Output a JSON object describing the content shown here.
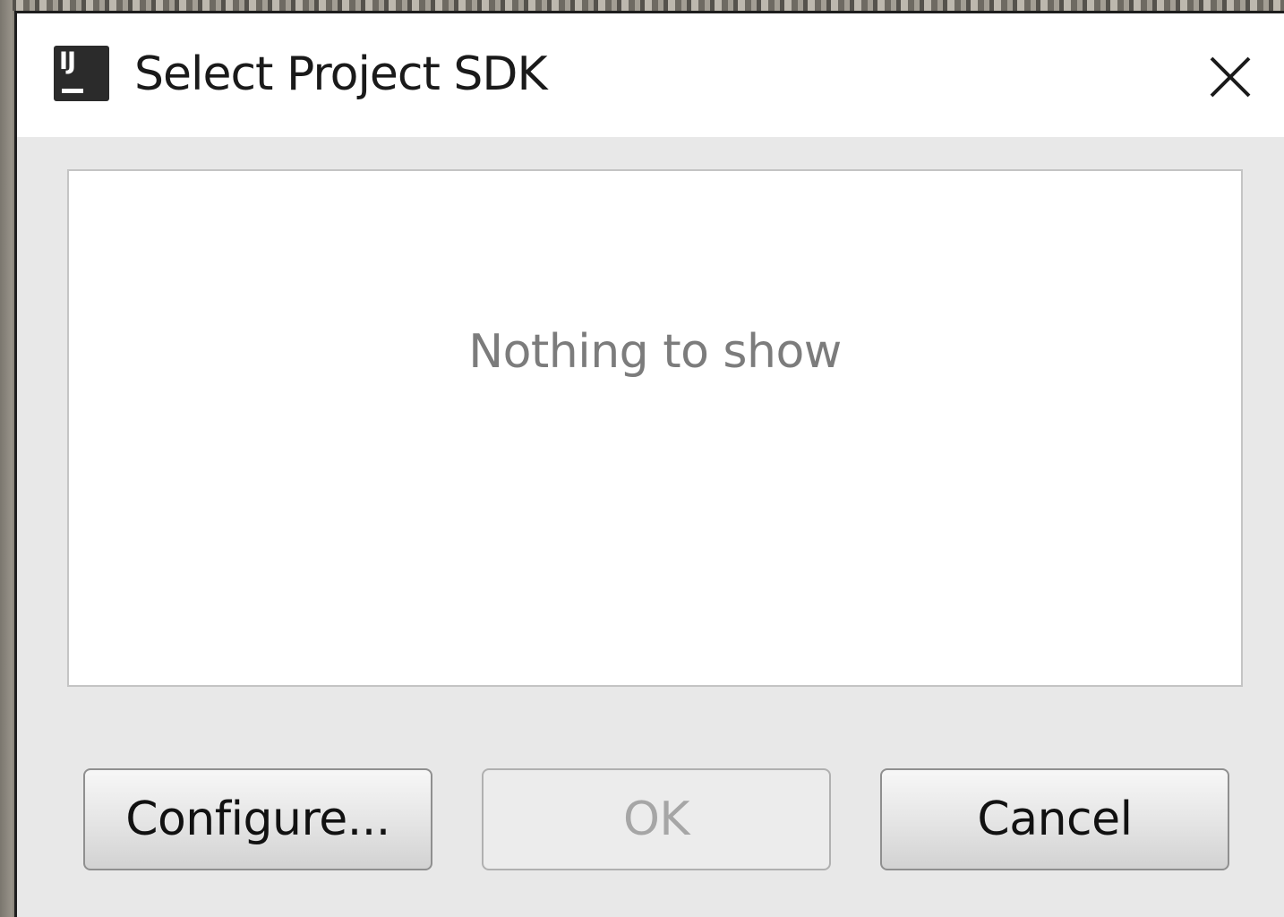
{
  "window": {
    "title": "Select Project SDK",
    "app_icon": {
      "name": "intellij-idea-icon",
      "text": "IJ"
    },
    "close_icon": "close-icon"
  },
  "list": {
    "empty_text": "Nothing to show"
  },
  "buttons": {
    "configure_label": "Configure...",
    "ok_label": "OK",
    "ok_enabled": false,
    "cancel_label": "Cancel"
  },
  "colors": {
    "dialog_bg": "#e8e8e8",
    "titlebar_bg": "#ffffff",
    "empty_text": "#7c7c7c",
    "disabled_text": "#a6a6a6"
  }
}
